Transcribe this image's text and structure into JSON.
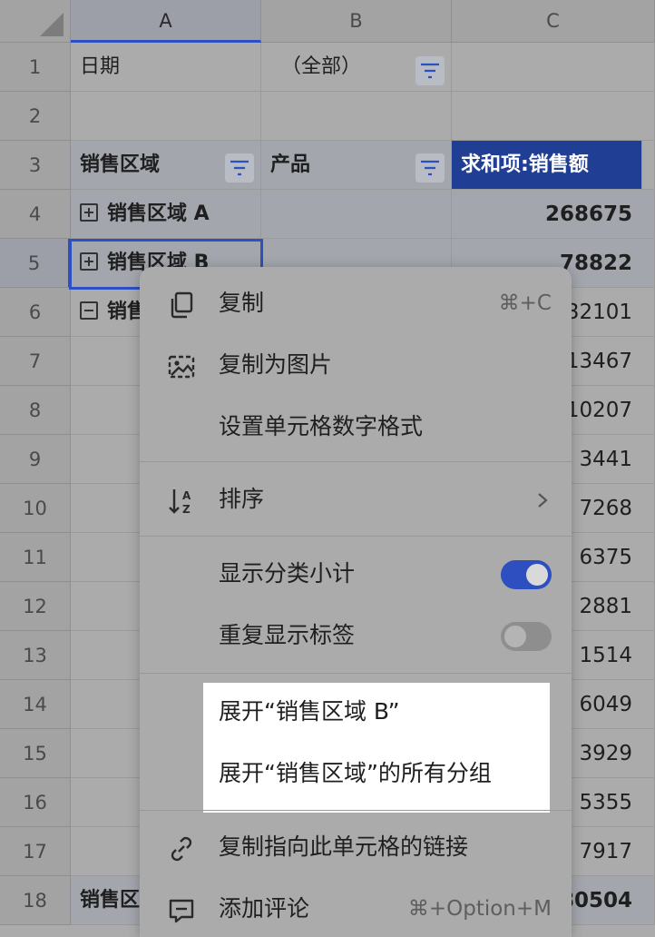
{
  "columns": [
    "A",
    "B",
    "C"
  ],
  "rows": [
    "1",
    "2",
    "3",
    "4",
    "5",
    "6",
    "7",
    "8",
    "9",
    "10",
    "11",
    "12",
    "13",
    "14",
    "15",
    "16",
    "17",
    "18"
  ],
  "cells": {
    "a1": "日期",
    "b1": "（全部）",
    "a3": "销售区域",
    "b3": "产品",
    "c3": "求和项:销售额",
    "a4": "销售区域 A",
    "c4": "268675",
    "a5": "销售区域 B",
    "c5": "78822",
    "a6": "销售区域",
    "c6": "132101",
    "c7": "13467",
    "c8": "10207",
    "c9": "3441",
    "c10": "7268",
    "c11": "6375",
    "c12": "2881",
    "c13": "1514",
    "c14": "6049",
    "c15": "3929",
    "c16": "5355",
    "c17": "7917",
    "a18": "销售区域",
    "c18": "480504"
  },
  "menu": {
    "copy": {
      "label": "复制",
      "shortcut": "⌘+C",
      "icon": "copy-icon"
    },
    "copy_as_image": {
      "label": "复制为图片",
      "icon": "image-icon"
    },
    "number_format": {
      "label": "设置单元格数字格式"
    },
    "sort": {
      "label": "排序",
      "icon": "sort-az-icon"
    },
    "show_subtotals": {
      "label": "显示分类小计",
      "on": true
    },
    "repeat_labels": {
      "label": "重复显示标签",
      "on": false
    },
    "expand_b": {
      "label": "展开“销售区域 B”"
    },
    "expand_all": {
      "label": "展开“销售区域”的所有分组"
    },
    "copy_link": {
      "label": "复制指向此单元格的链接",
      "icon": "link-icon"
    },
    "add_comment": {
      "label": "添加评论",
      "shortcut": "⌘+Option+M",
      "icon": "comment-icon"
    }
  },
  "colors": {
    "accent": "#2d4fc0",
    "header_blue": "#203f94"
  }
}
